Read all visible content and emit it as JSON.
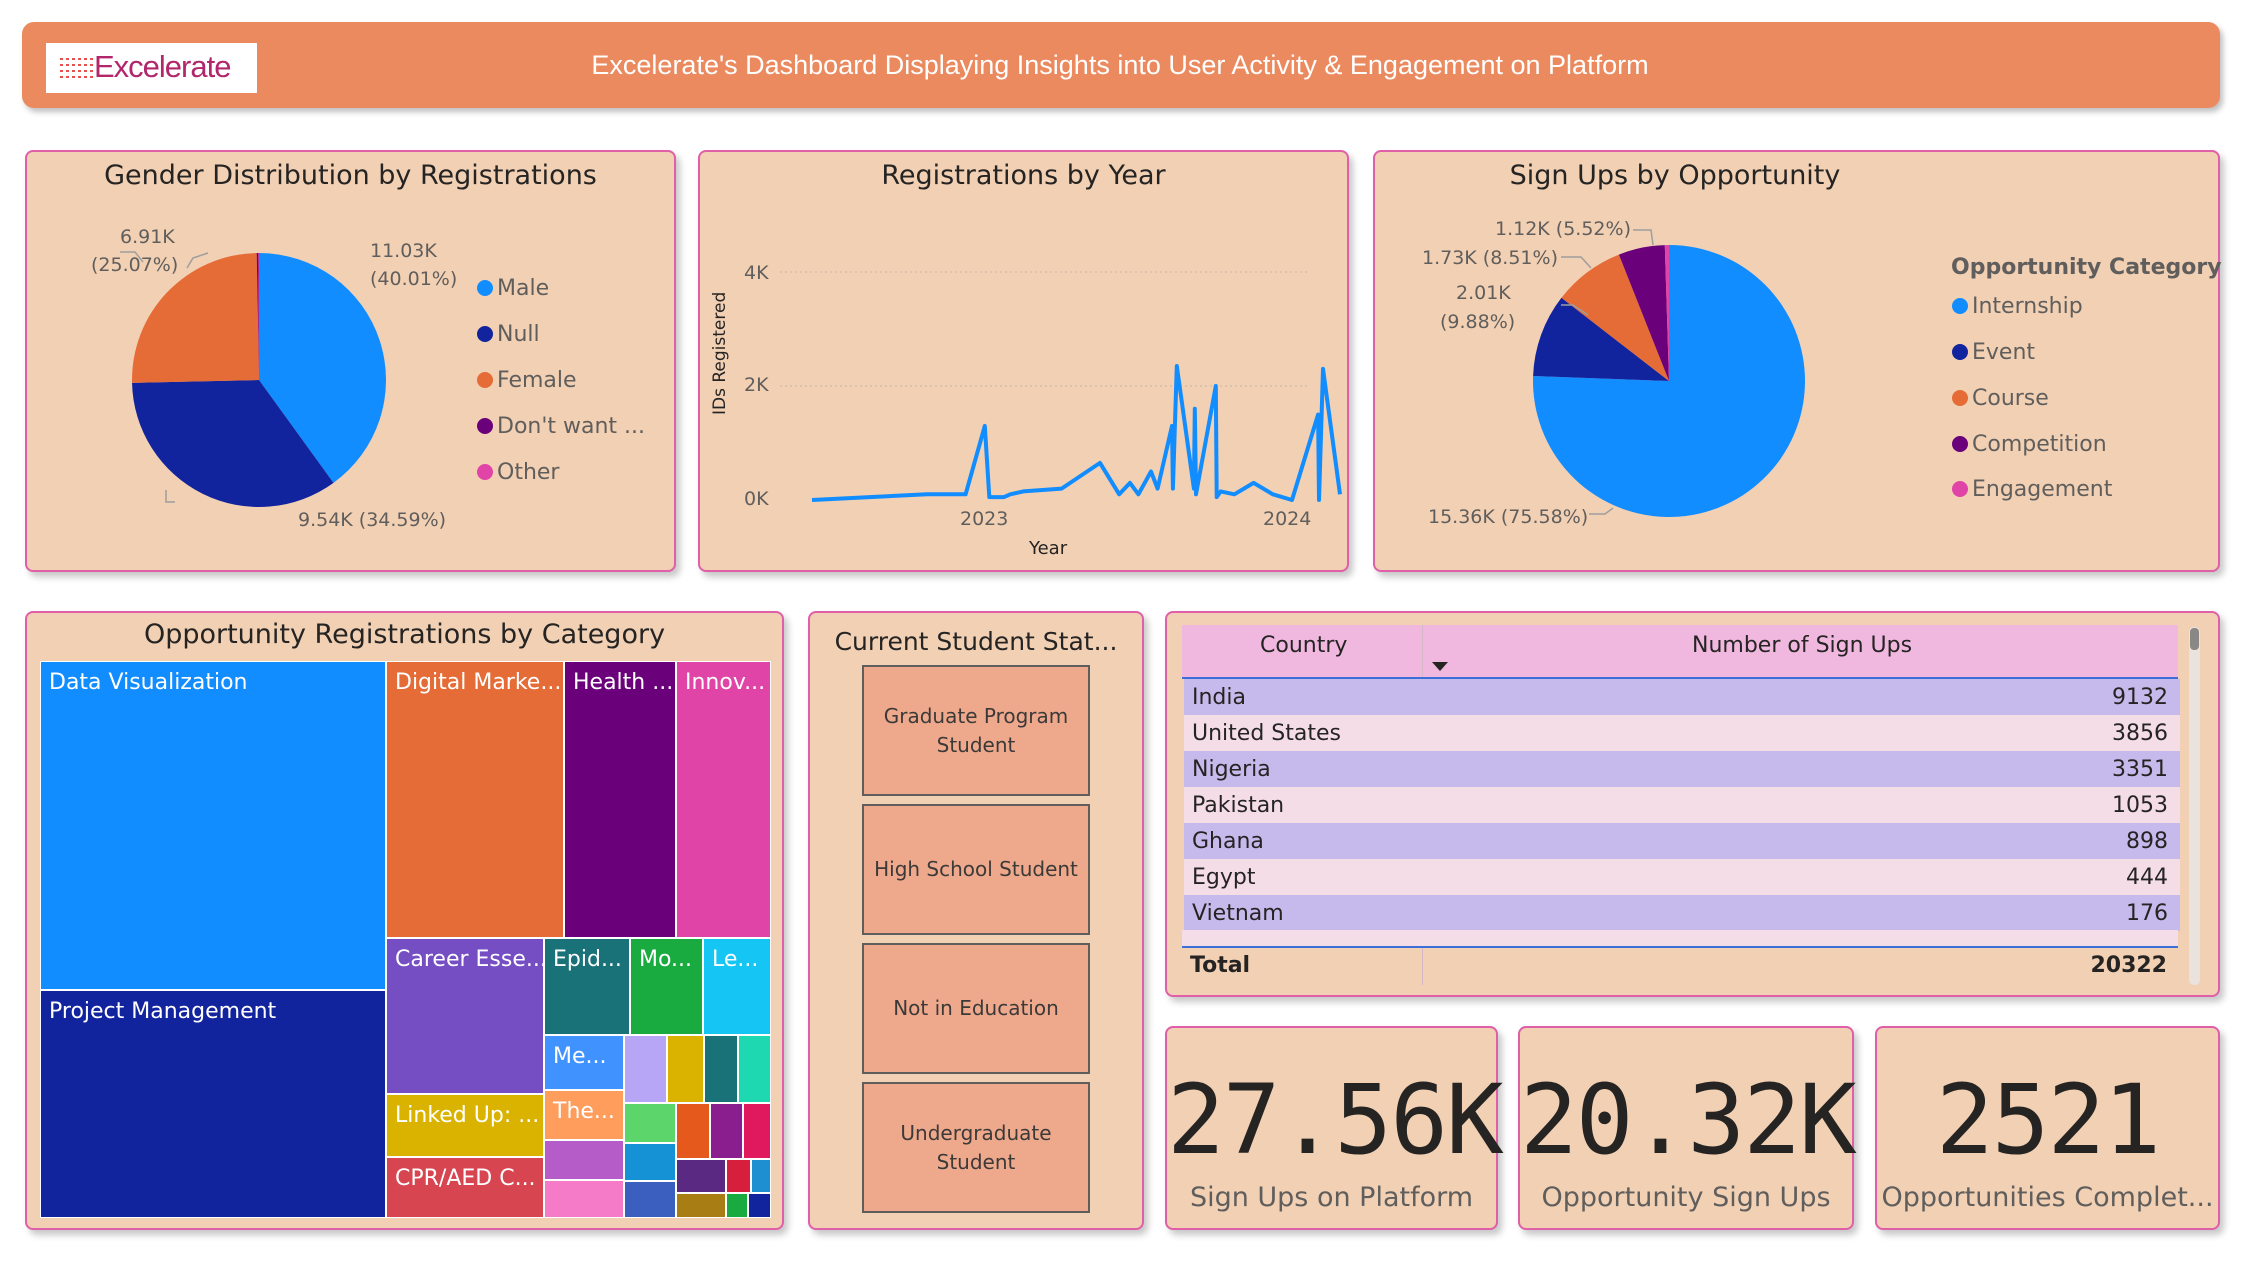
{
  "header": {
    "logo_text": "Excelerate",
    "title": "Excelerate's Dashboard Displaying Insights into User Activity & Engagement on Platform"
  },
  "gender_chart": {
    "title": "Gender Distribution by Registrations",
    "labels": {
      "male": [
        "11.03K",
        "(40.01%)"
      ],
      "female": [
        "6.91K",
        "(25.07%)"
      ],
      "null": "9.54K (34.59%)"
    },
    "legend": [
      "Male",
      "Null",
      "Female",
      "Don't want ...",
      "Other"
    ]
  },
  "year_chart": {
    "title": "Registrations by Year",
    "ylabel": "IDs Registered",
    "xlabel": "Year",
    "yticks": [
      "4K",
      "2K",
      "0K"
    ],
    "xticks": [
      "2023",
      "2024"
    ]
  },
  "opportunity_chart": {
    "title": "Sign Ups by Opportunity",
    "legend_title": "Opportunity Category",
    "legend": [
      "Internship",
      "Event",
      "Course",
      "Competition",
      "Engagement"
    ],
    "labels": {
      "competition": "1.12K (5.52%)",
      "course": "1.73K (8.51%)",
      "event": [
        "2.01K",
        "(9.88%)"
      ],
      "internship": "15.36K (75.58%)"
    }
  },
  "treemap": {
    "title": "Opportunity Registrations by Category",
    "tiles": [
      "Data Visualization",
      "Project Management",
      "Digital Marke...",
      "Health ...",
      "Innov...",
      "Career Esse...",
      "Epid...",
      "Mo...",
      "Le...",
      "Me...",
      "Linked Up: ...",
      "The...",
      "CPR/AED C..."
    ]
  },
  "student_status": {
    "title": "Current Student Stat...",
    "options": [
      [
        "Graduate Program",
        "Student"
      ],
      [
        "High School Student"
      ],
      [
        "Not in Education"
      ],
      [
        "Undergraduate",
        "Student"
      ]
    ]
  },
  "country_table": {
    "columns": [
      "Country",
      "Number of Sign Ups"
    ],
    "rows": [
      [
        "India",
        "9132"
      ],
      [
        "United States",
        "3856"
      ],
      [
        "Nigeria",
        "3351"
      ],
      [
        "Pakistan",
        "1053"
      ],
      [
        "Ghana",
        "898"
      ],
      [
        "Egypt",
        "444"
      ],
      [
        "Vietnam",
        "176"
      ]
    ],
    "total_label": "Total",
    "total_value": "20322"
  },
  "kpis": [
    {
      "value": "27.56K",
      "label": "Sign Ups on Platform"
    },
    {
      "value": "20.32K",
      "label": "Opportunity Sign Ups"
    },
    {
      "value": "2521",
      "label": "Opportunities Complet..."
    }
  ],
  "colors": {
    "male": "#118dff",
    "null": "#12239e",
    "female": "#e66c37",
    "dont_want": "#6b007b",
    "other": "#e044a7",
    "header": "#eb8a5f",
    "card_bg": "#f2d0b4",
    "card_border": "#df5fa8"
  },
  "chart_data": [
    {
      "type": "pie",
      "title": "Gender Distribution by Registrations",
      "categories": [
        "Male",
        "Null",
        "Female",
        "Don't want ...",
        "Other"
      ],
      "values": [
        11030,
        9540,
        6910,
        60,
        20
      ],
      "percent": [
        40.01,
        34.59,
        25.07,
        0.2,
        0.1
      ]
    },
    {
      "type": "line",
      "title": "Registrations by Year",
      "xlabel": "Year",
      "ylabel": "IDs Registered",
      "ylim": [
        0,
        4000
      ],
      "x": [
        "2022-04",
        "2022-07",
        "2022-10",
        "2022-12",
        "2023-01",
        "2023-01",
        "2023-02",
        "2023-02",
        "2023-03",
        "2023-05",
        "2023-07",
        "2023-08",
        "2023-08",
        "2023-09",
        "2023-09",
        "2023-10",
        "2023-10",
        "2023-10",
        "2023-11",
        "2023-11",
        "2023-11",
        "2023-12",
        "2023-12",
        "2023-12",
        "2024-01",
        "2024-02",
        "2024-03",
        "2024-04",
        "2024-05",
        "2024-05",
        "2024-05",
        "2024-06",
        "2024-06"
      ],
      "y": [
        0,
        50,
        100,
        100,
        1300,
        50,
        50,
        100,
        150,
        200,
        650,
        100,
        300,
        100,
        500,
        200,
        1300,
        200,
        2350,
        200,
        1600,
        100,
        2000,
        50,
        150,
        100,
        300,
        100,
        0,
        1500,
        0,
        2300,
        100
      ]
    },
    {
      "type": "pie",
      "title": "Sign Ups by Opportunity",
      "categories": [
        "Internship",
        "Event",
        "Course",
        "Competition",
        "Engagement"
      ],
      "values": [
        15360,
        2010,
        1730,
        1120,
        100
      ],
      "percent": [
        75.58,
        9.88,
        8.51,
        5.52,
        0.5
      ]
    }
  ]
}
